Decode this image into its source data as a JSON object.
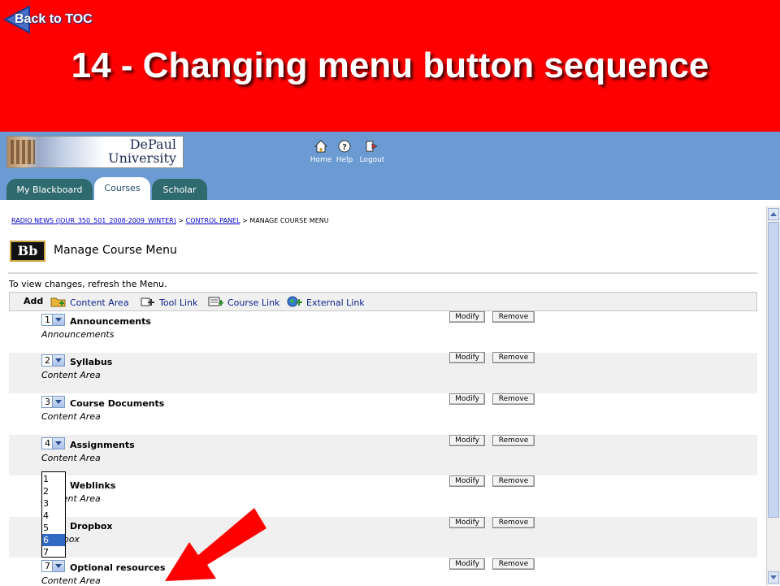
{
  "slide": {
    "back_to_toc": "Back to TOC",
    "title": "14 - Changing menu button sequence"
  },
  "banner": {
    "logo_line1": "DePaul",
    "logo_line2": "University",
    "nav": [
      {
        "label": "Home",
        "icon": "home-icon"
      },
      {
        "label": "Help",
        "icon": "help-icon"
      },
      {
        "label": "Logout",
        "icon": "logout-icon"
      }
    ],
    "tabs": [
      {
        "label": "My Blackboard",
        "active": false
      },
      {
        "label": "Courses",
        "active": true
      },
      {
        "label": "Scholar",
        "active": false
      }
    ]
  },
  "breadcrumb": {
    "course": "RADIO NEWS (JOUR_350_501_2008-2009_WINTER)",
    "sep1": " > ",
    "control_panel": "CONTROL PANEL",
    "sep2": " > ",
    "current": "MANAGE COURSE MENU"
  },
  "page": {
    "bb_logo": "Bb",
    "title": "Manage Course Menu",
    "refresh_note": "To view changes, refresh the Menu."
  },
  "add_bar": {
    "label": "Add",
    "items": [
      {
        "label": "Content Area",
        "icon": "folder-add-icon"
      },
      {
        "label": "Tool Link",
        "icon": "tool-add-icon"
      },
      {
        "label": "Course Link",
        "icon": "course-link-add-icon"
      },
      {
        "label": "External Link",
        "icon": "globe-add-icon"
      }
    ]
  },
  "buttons": {
    "modify": "Modify",
    "remove": "Remove"
  },
  "menu_items": [
    {
      "seq": "1",
      "name": "Announcements",
      "type": "Announcements"
    },
    {
      "seq": "2",
      "name": "Syllabus",
      "type": "Content Area"
    },
    {
      "seq": "3",
      "name": "Course Documents",
      "type": "Content Area"
    },
    {
      "seq": "4",
      "name": "Assignments",
      "type": "Content Area"
    },
    {
      "seq": "5",
      "name": "Weblinks",
      "type": "Content Area"
    },
    {
      "seq": "6",
      "name": "Dropbox",
      "type": "Dropbox"
    },
    {
      "seq": "7",
      "name": "Optional resources",
      "type": "Content Area"
    }
  ],
  "dropdown": {
    "options": [
      "1",
      "2",
      "3",
      "4",
      "5",
      "6",
      "7"
    ],
    "highlighted": "6"
  },
  "colors": {
    "slide_red": "#ff0000",
    "banner_blue": "#6b9bd2",
    "tab_teal": "#2f6a6e",
    "selection_blue": "#316ac5"
  }
}
